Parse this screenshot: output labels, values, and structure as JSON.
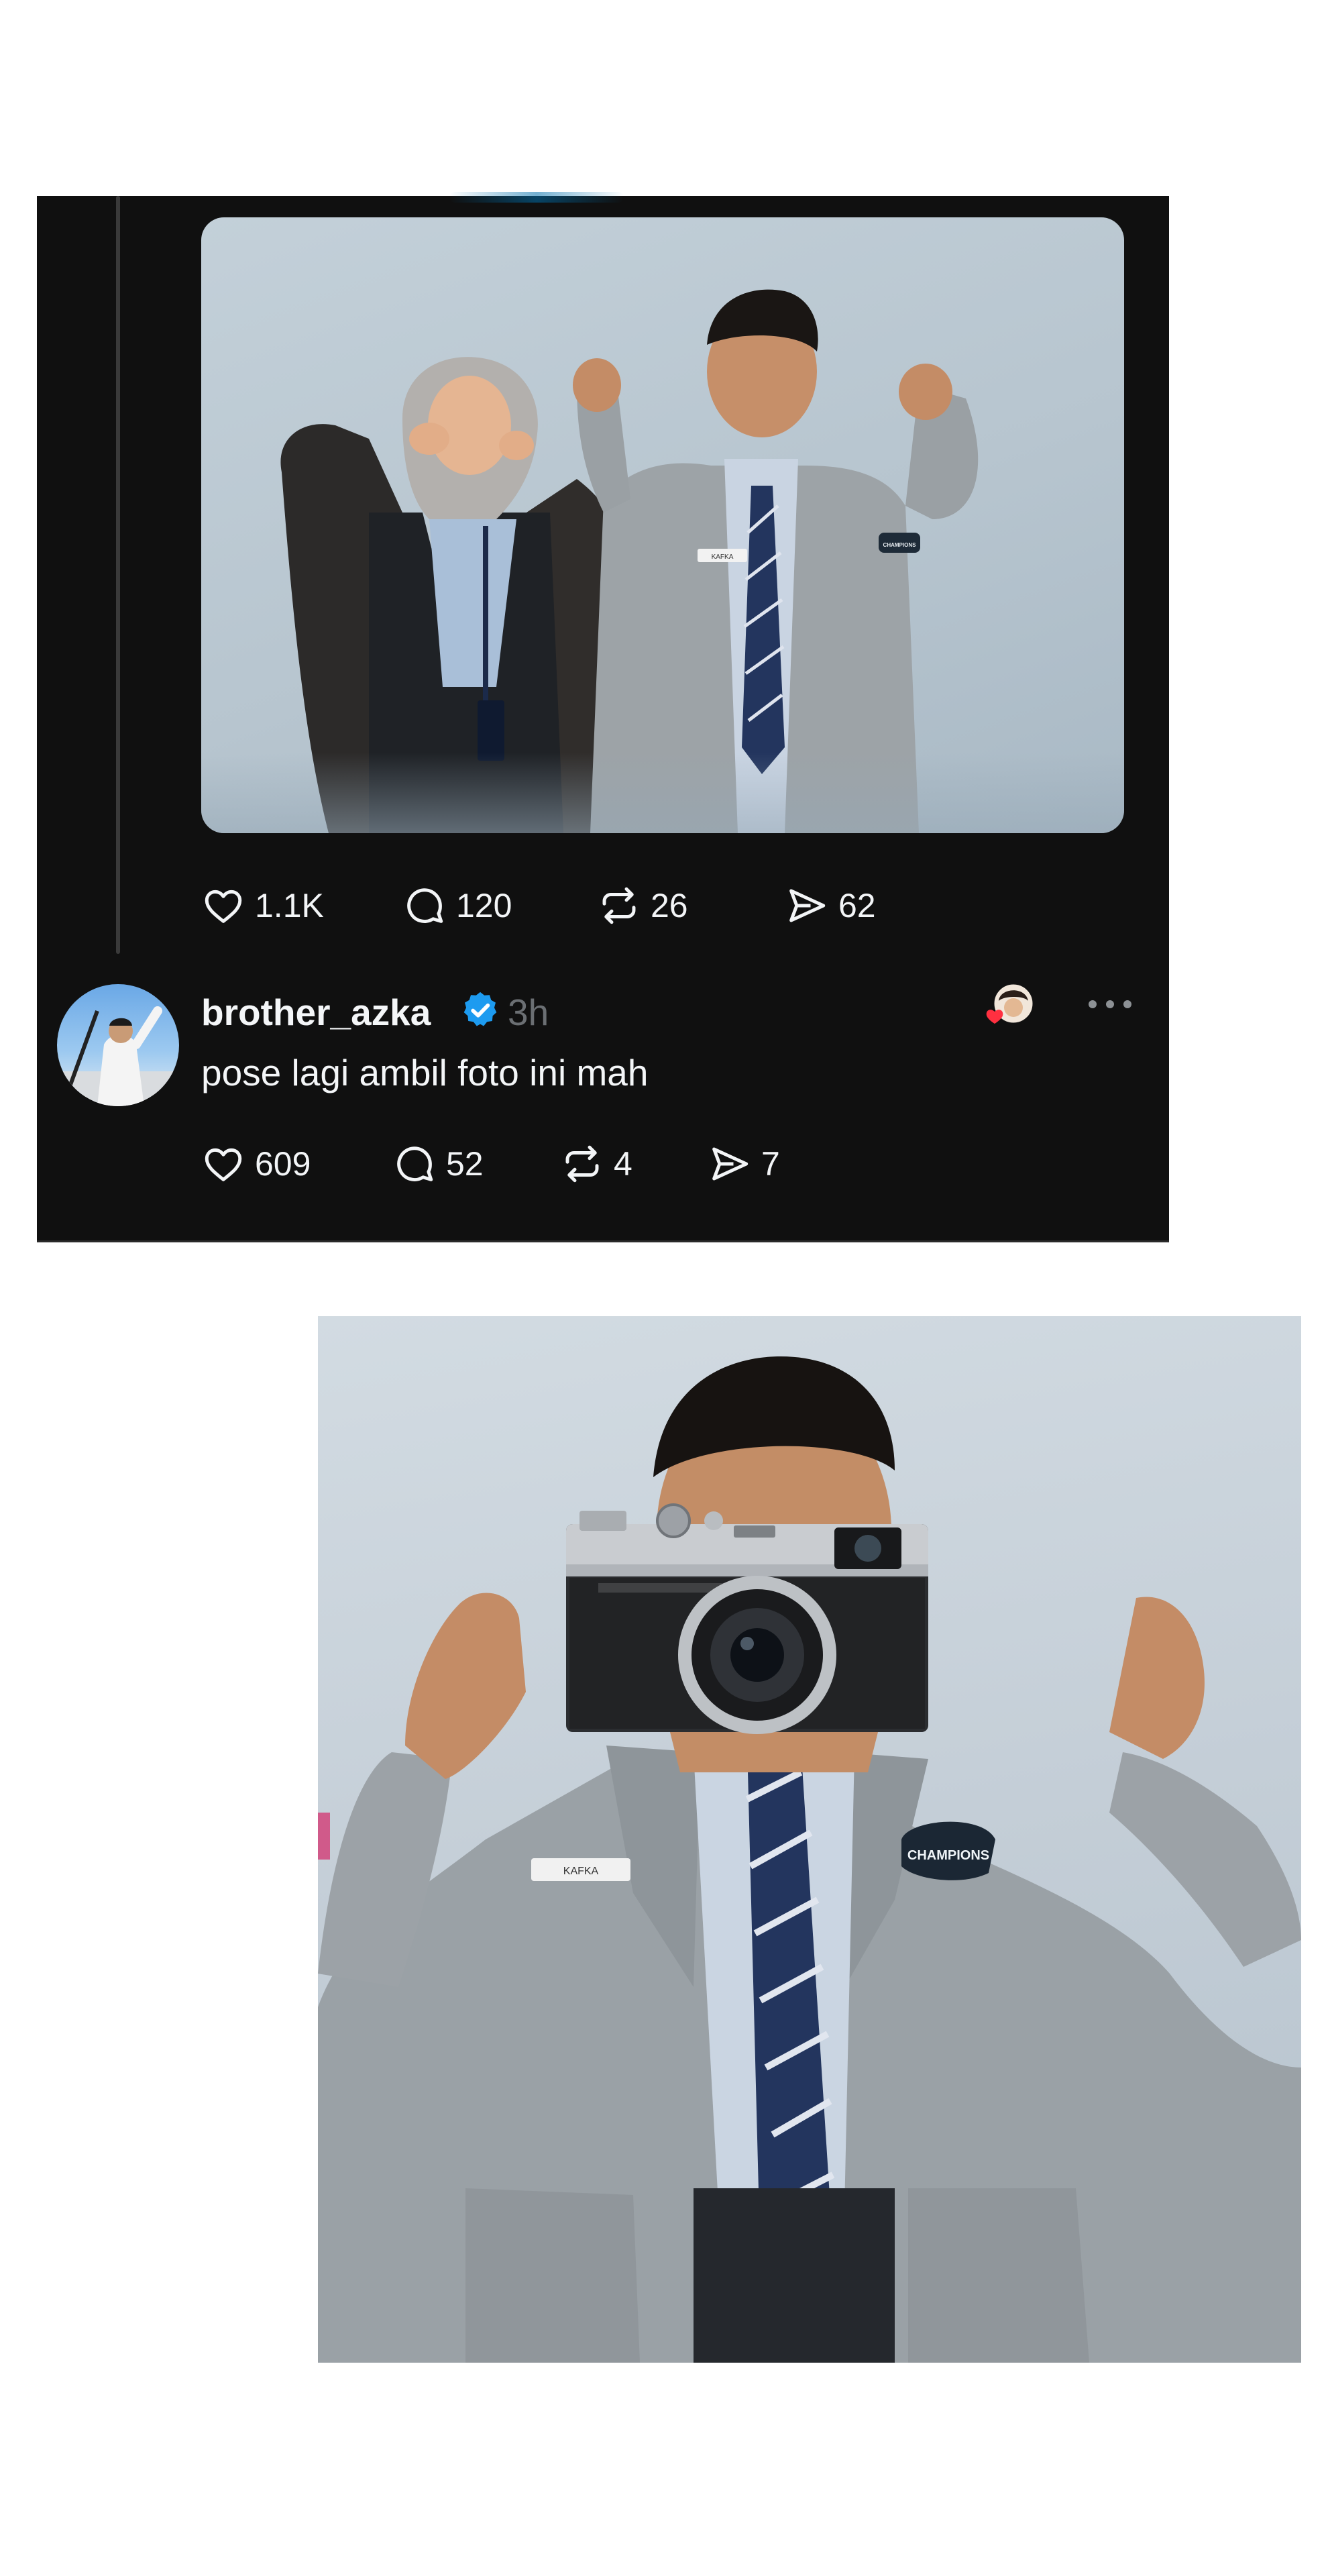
{
  "post1": {
    "stats": {
      "likes": "1.1K",
      "replies": "120",
      "reposts": "26",
      "shares": "62"
    },
    "photo": {
      "name_tag": "KAFKA",
      "badge": "CHAMPIONS"
    }
  },
  "post2": {
    "username": "brother_azka",
    "time": "3h",
    "text": "pose lagi ambil foto ini mah",
    "stats": {
      "likes": "609",
      "replies": "52",
      "reposts": "4",
      "shares": "7"
    }
  },
  "edited_photo": {
    "name_tag": "KAFKA",
    "badge": "CHAMPIONS"
  },
  "colors": {
    "card_bg": "#101010",
    "text": "#f4f6f8",
    "muted": "#6b6f73",
    "verified": "#1d9bf0",
    "heart": "#ff3040"
  },
  "icons": [
    "heart-icon",
    "reply-icon",
    "repost-icon",
    "share-icon",
    "verified-icon",
    "more-icon",
    "camera-icon"
  ]
}
